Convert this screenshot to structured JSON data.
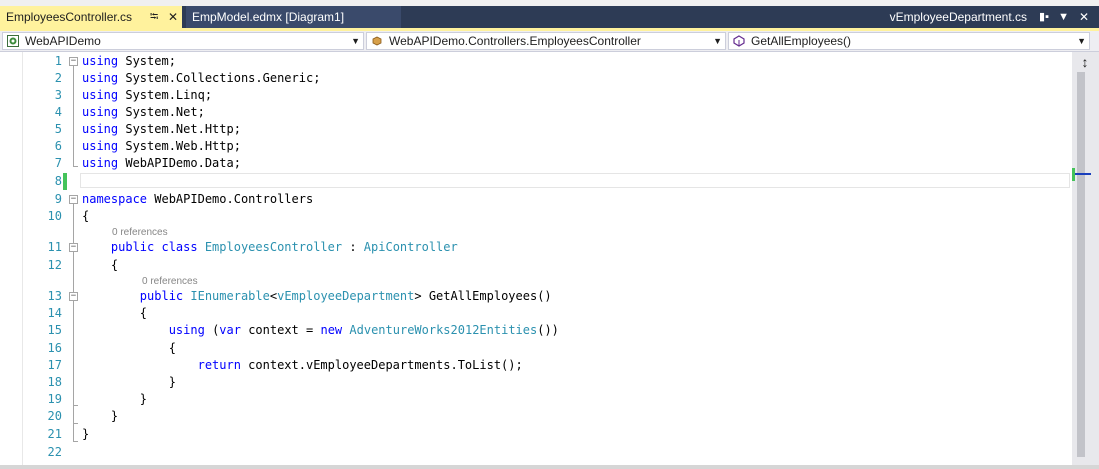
{
  "tabs": [
    {
      "label": "EmployeesController.cs",
      "active": true
    },
    {
      "label": "EmpModel.edmx [Diagram1]",
      "active": false
    }
  ],
  "right_tab": {
    "label": "vEmployeeDepartment.cs"
  },
  "icons": {
    "pin": "pin-icon",
    "close": "close-icon",
    "dropdown": "chevron-down-icon",
    "project": "csharp-project-icon",
    "class": "class-icon",
    "method": "method-icon",
    "split": "split-icon"
  },
  "navbar": {
    "project": "WebAPIDemo",
    "type": "WebAPIDemo.Controllers.EmployeesController",
    "member": "GetAllEmployees()"
  },
  "colors": {
    "keyword": "#0000ff",
    "type": "#2b91af",
    "line_number": "#2b91af",
    "active_tab": "#fff29d",
    "tab_strip": "#2d3b55",
    "change_bar": "#44c35a"
  },
  "code": {
    "lines": [
      {
        "n": "1",
        "text": "using System;"
      },
      {
        "n": "2",
        "text": "using System.Collections.Generic;"
      },
      {
        "n": "3",
        "text": "using System.Linq;"
      },
      {
        "n": "4",
        "text": "using System.Net;"
      },
      {
        "n": "5",
        "text": "using System.Net.Http;"
      },
      {
        "n": "6",
        "text": "using System.Web.Http;"
      },
      {
        "n": "7",
        "text": "using WebAPIDemo.Data;"
      },
      {
        "n": "8",
        "text": ""
      },
      {
        "n": "9",
        "text": "namespace WebAPIDemo.Controllers"
      },
      {
        "n": "10",
        "text": "{"
      },
      {
        "n": "11",
        "text": "    public class EmployeesController : ApiController"
      },
      {
        "n": "12",
        "text": "    {"
      },
      {
        "n": "13",
        "text": "        public IEnumerable<vEmployeeDepartment> GetAllEmployees()"
      },
      {
        "n": "14",
        "text": "        {"
      },
      {
        "n": "15",
        "text": "            using (var context = new AdventureWorks2012Entities())"
      },
      {
        "n": "16",
        "text": "            {"
      },
      {
        "n": "17",
        "text": "                return context.vEmployeeDepartments.ToList();"
      },
      {
        "n": "18",
        "text": "            }"
      },
      {
        "n": "19",
        "text": "        }"
      },
      {
        "n": "20",
        "text": "    }"
      },
      {
        "n": "21",
        "text": "}"
      },
      {
        "n": "22",
        "text": ""
      }
    ],
    "lens_class": "0 references",
    "lens_method": "0 references"
  }
}
